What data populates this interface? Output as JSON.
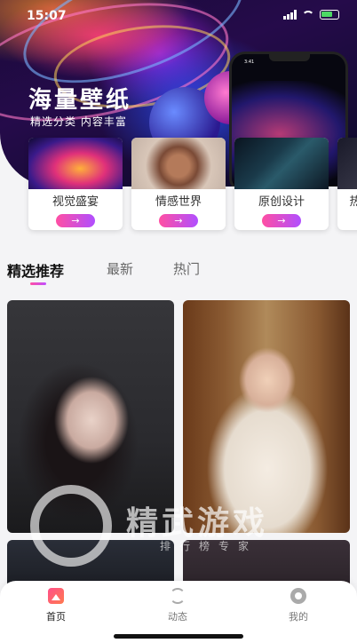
{
  "status_bar": {
    "time": "15:07"
  },
  "hero": {
    "title": "海量壁纸",
    "subtitle": "精选分类 内容丰富",
    "phone_time": "3:41"
  },
  "categories": [
    {
      "label": "视觉盛宴",
      "button": "→"
    },
    {
      "label": "情感世界",
      "button": "→"
    },
    {
      "label": "原创设计",
      "button": "→"
    },
    {
      "label": "热",
      "button": ""
    }
  ],
  "tabs": [
    {
      "label": "精选推荐",
      "active": true
    },
    {
      "label": "最新",
      "active": false
    },
    {
      "label": "热门",
      "active": false
    }
  ],
  "watermark": {
    "brand": "精武游戏",
    "tagline": "排行榜专家"
  },
  "bottom_nav": [
    {
      "label": "首页",
      "icon": "home-icon",
      "active": true
    },
    {
      "label": "动态",
      "icon": "dynamic-icon",
      "active": false
    },
    {
      "label": "我的",
      "icon": "profile-icon",
      "active": false
    }
  ],
  "colors": {
    "accent_start": "#ff4fa3",
    "accent_end": "#b04fff"
  }
}
